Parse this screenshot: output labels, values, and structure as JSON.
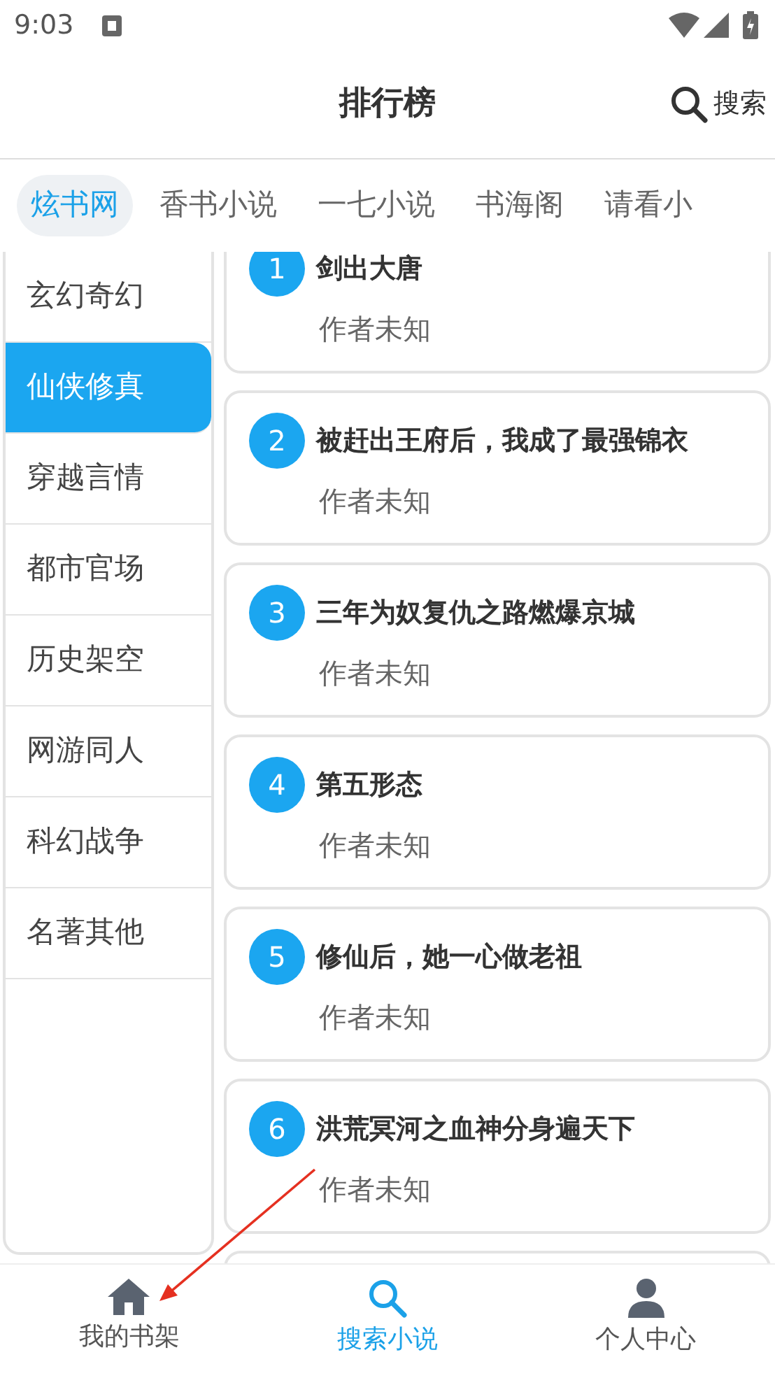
{
  "status_bar": {
    "time": "9:03"
  },
  "header": {
    "title": "排行榜",
    "search_label": "搜索"
  },
  "sources": [
    {
      "label": "炫书网",
      "selected": true
    },
    {
      "label": "香书小说",
      "selected": false
    },
    {
      "label": "一七小说",
      "selected": false
    },
    {
      "label": "书海阁",
      "selected": false
    },
    {
      "label": "请看小",
      "selected": false
    }
  ],
  "categories": [
    {
      "label": "玄幻奇幻",
      "selected": false
    },
    {
      "label": "仙侠修真",
      "selected": true
    },
    {
      "label": "穿越言情",
      "selected": false
    },
    {
      "label": "都市官场",
      "selected": false
    },
    {
      "label": "历史架空",
      "selected": false
    },
    {
      "label": "网游同人",
      "selected": false
    },
    {
      "label": "科幻战争",
      "selected": false
    },
    {
      "label": "名著其他",
      "selected": false
    }
  ],
  "books": [
    {
      "rank": "1",
      "title": "剑出大唐",
      "author": "作者未知"
    },
    {
      "rank": "2",
      "title": "被赶出王府后，我成了最强锦衣",
      "author": "作者未知"
    },
    {
      "rank": "3",
      "title": "三年为奴复仇之路燃爆京城",
      "author": "作者未知"
    },
    {
      "rank": "4",
      "title": "第五形态",
      "author": "作者未知"
    },
    {
      "rank": "5",
      "title": "修仙后，她一心做老祖",
      "author": "作者未知"
    },
    {
      "rank": "6",
      "title": "洪荒冥河之血神分身遍天下",
      "author": "作者未知"
    }
  ],
  "bottom_nav": [
    {
      "kind": "home",
      "label": "我的书架",
      "selected": false
    },
    {
      "kind": "search",
      "label": "搜索小说",
      "selected": true
    },
    {
      "kind": "person",
      "label": "个人中心",
      "selected": false
    }
  ]
}
